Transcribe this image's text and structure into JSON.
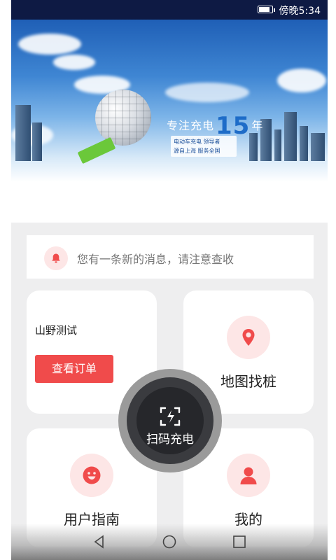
{
  "status_bar": {
    "time": "傍晚5:34",
    "battery_icon": "battery-icon",
    "battery_level": 0.75
  },
  "banner": {
    "slogan_prefix": "专注充电",
    "slogan_number": "15",
    "slogan_suffix": "年",
    "sub_line1": "电动车充电  领导者",
    "sub_line2": "源自上海  服务全国"
  },
  "notice": {
    "icon": "bell-icon",
    "text": "您有一条新的消息，请注意查收"
  },
  "orders_card": {
    "site_name": "山野测试",
    "button_label": "查看订单"
  },
  "map_card": {
    "icon": "location-pin-icon",
    "label": "地图找桩"
  },
  "scan": {
    "icon": "scan-charge-icon",
    "label": "扫码充电"
  },
  "guide_card": {
    "icon": "smiley-icon",
    "label": "用户指南"
  },
  "me_card": {
    "icon": "user-icon",
    "label": "我的"
  },
  "nav_bar": {
    "back": "back-icon",
    "home": "home-icon",
    "recents": "recents-icon"
  },
  "colors": {
    "accent": "#f04b4b",
    "accent_light": "#fde6e6",
    "status_bar": "#0e1a44",
    "scan_dark": "#26272b"
  }
}
